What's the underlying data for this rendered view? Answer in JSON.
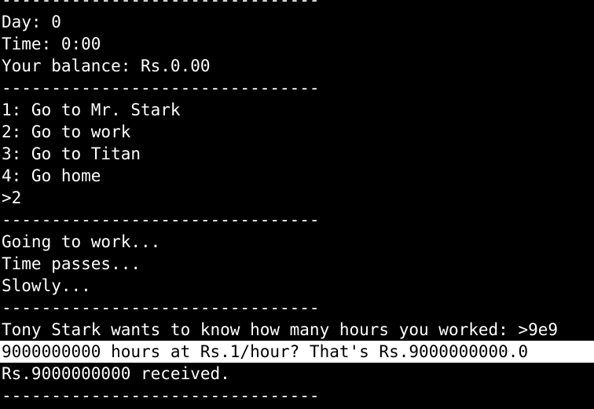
{
  "terminal": {
    "background": "#000000",
    "foreground": "#ffffff",
    "highlight_background": "#ffffff",
    "highlight_foreground": "#000000",
    "lines": [
      "--------------------------------",
      "Day: 0",
      "Time: 0:00",
      "Your balance: Rs.0.00",
      "--------------------------------",
      "1: Go to Mr. Stark",
      "2: Go to work",
      "3: Go to Titan",
      "4: Go home",
      ">2",
      "--------------------------------",
      "Going to work...",
      "Time passes...",
      "Slowly...",
      "--------------------------------",
      "Tony Stark wants to know how many hours you worked: >9e9",
      "9000000000 hours at Rs.1/hour? That's Rs.9000000000.0",
      "Rs.9000000000 received.",
      "--------------------------------"
    ]
  }
}
